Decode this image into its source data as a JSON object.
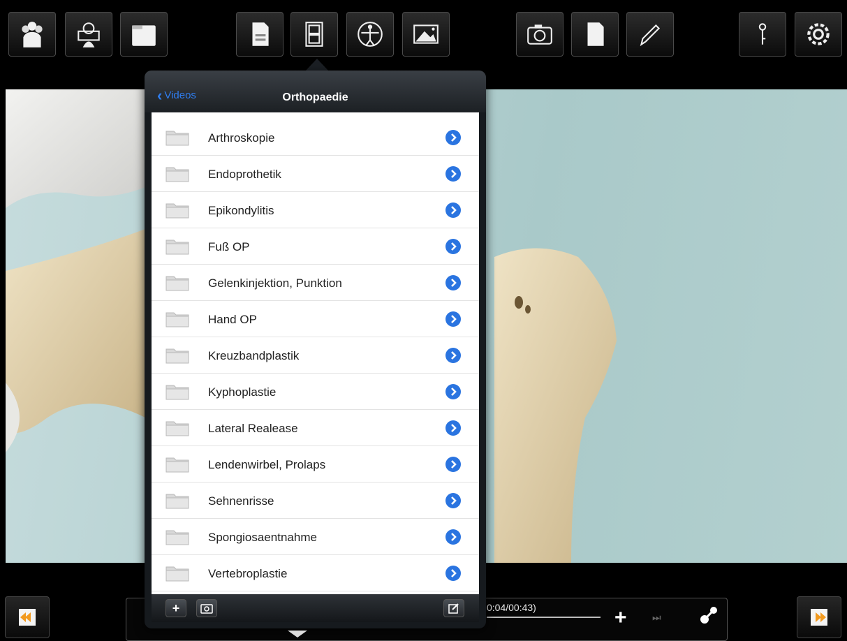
{
  "toolbar": {
    "left_buttons": [
      "people-icon",
      "anatomy-view-icon",
      "folder-icon"
    ],
    "center_buttons": [
      "document-save-icon",
      "film-icon",
      "vitruvian-man-icon",
      "image-icon"
    ],
    "right_buttons": [
      "camera-icon",
      "blank-page-icon",
      "pencil-icon"
    ],
    "far_right_buttons": [
      "pin-icon",
      "settings-icon"
    ]
  },
  "popover": {
    "back_label": "Videos",
    "title": "Orthopaedie",
    "items": [
      {
        "label": "Arthroskopie"
      },
      {
        "label": "Endoprothetik"
      },
      {
        "label": "Epikondylitis"
      },
      {
        "label": "Fuß OP"
      },
      {
        "label": "Gelenkinjektion, Punktion"
      },
      {
        "label": "Hand OP"
      },
      {
        "label": "Kreuzbandplastik"
      },
      {
        "label": "Kyphoplastie"
      },
      {
        "label": "Lateral Realease"
      },
      {
        "label": "Lendenwirbel, Prolaps"
      },
      {
        "label": "Sehnenrisse"
      },
      {
        "label": "Spongiosaentnahme"
      },
      {
        "label": "Vertebroplastie"
      }
    ],
    "footer": {
      "add": "+",
      "add_folder_icon": "folder-camera-icon",
      "edit_icon": "compose-icon"
    }
  },
  "player": {
    "time": "0:04/00:43)",
    "zoom": "+",
    "next_icon": "skip-forward-icon",
    "share_icon": "connect-icon"
  },
  "colors": {
    "accent": "#2f7ef0",
    "disclosure": "#2a74e0"
  }
}
